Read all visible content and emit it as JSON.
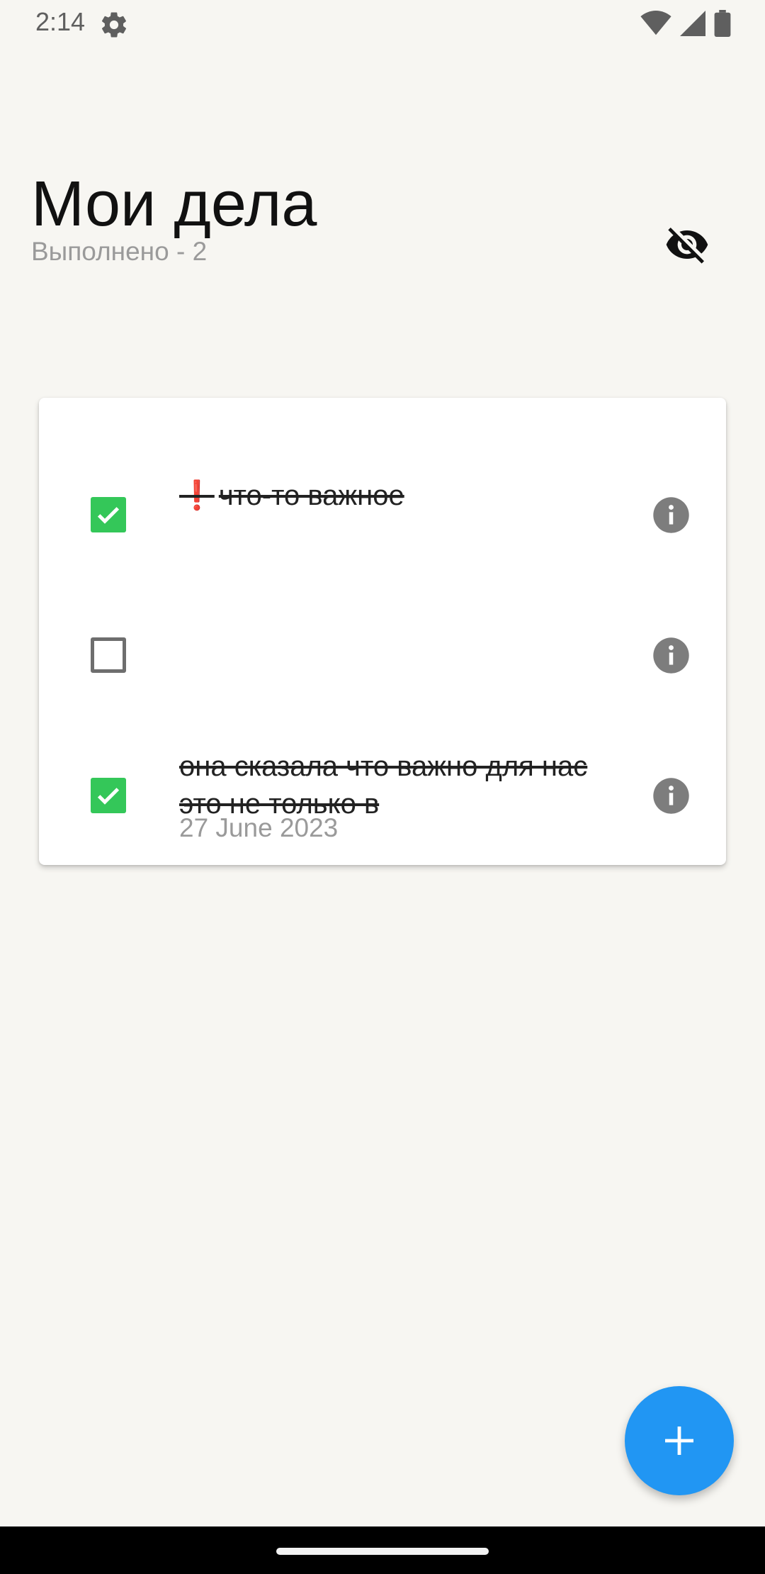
{
  "status_bar": {
    "time": "2:14",
    "icons": [
      "settings-gear-icon",
      "wifi-icon",
      "signal-icon",
      "battery-icon"
    ]
  },
  "header": {
    "title": "Мои дела",
    "completed_label": "Выполнено - 2",
    "visibility_icon": "visibility-off-icon"
  },
  "tasks": [
    {
      "done": true,
      "priority_mark": "❗",
      "text": "что-то важное",
      "date": ""
    },
    {
      "done": false,
      "text": "",
      "date": ""
    },
    {
      "done": true,
      "text": "она сказала что важно для нас это не только в",
      "date": "27 June 2023"
    }
  ],
  "fab": {
    "icon": "plus-icon"
  },
  "colors": {
    "background": "#f7f6f2",
    "checkbox_checked": "#34c759",
    "fab": "#2196f3",
    "info_icon": "#7d7d7d",
    "priority": "#e53935"
  }
}
